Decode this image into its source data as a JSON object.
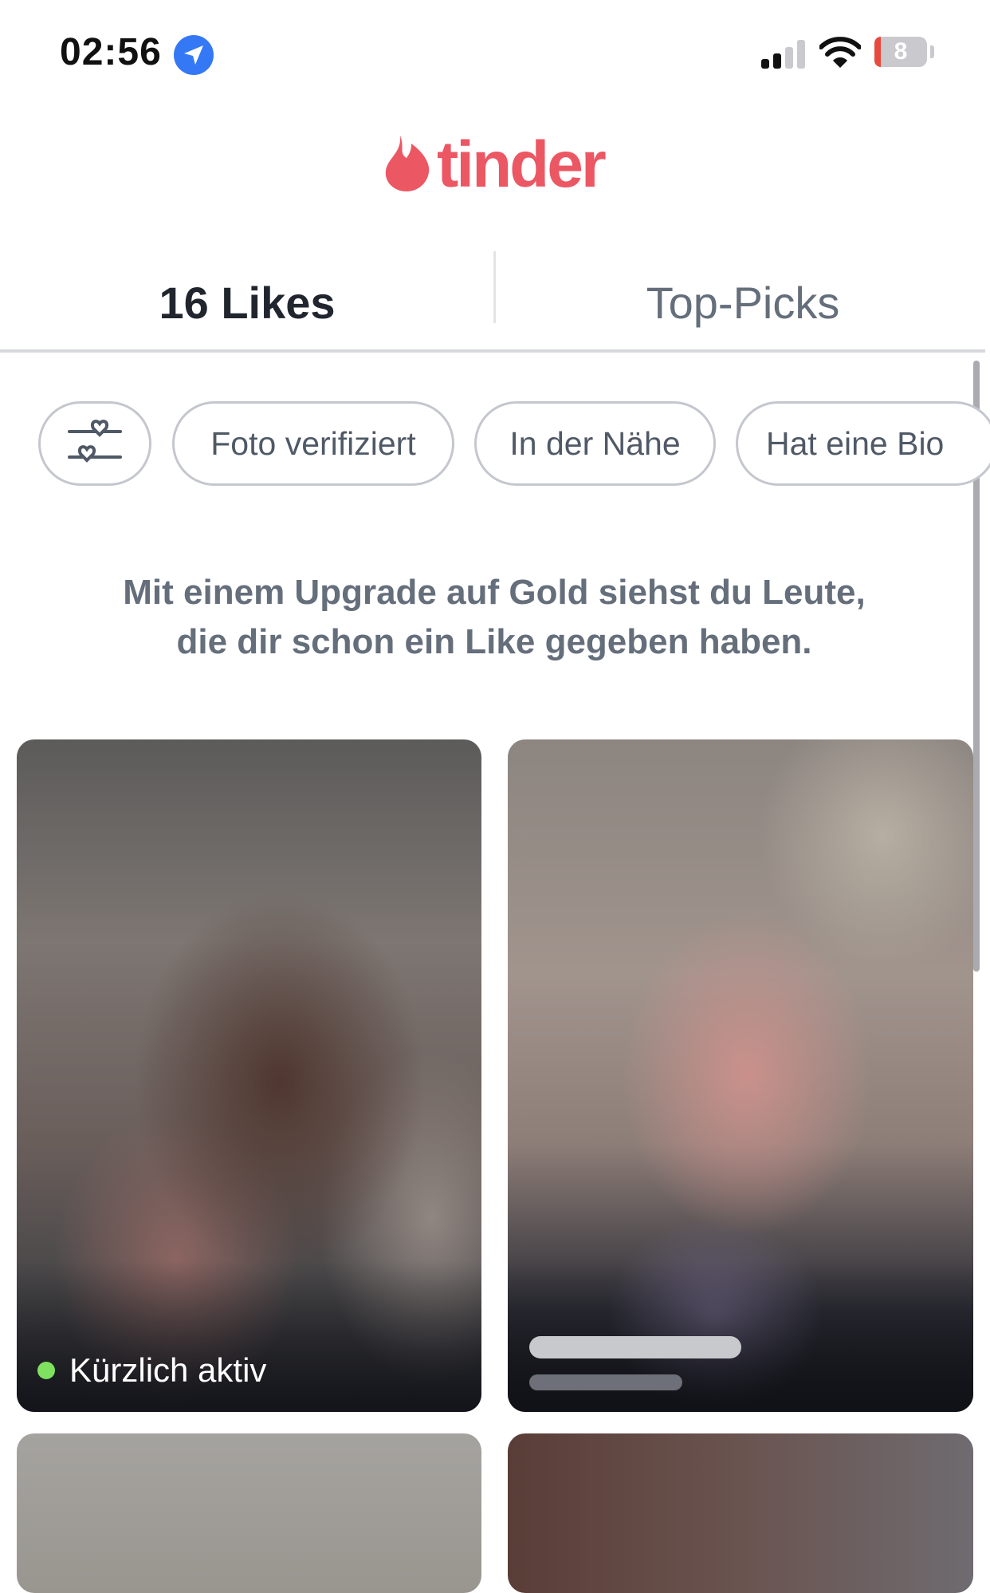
{
  "status_bar": {
    "time": "02:56",
    "battery_level": "8",
    "icons": [
      "location-arrow-icon",
      "cellular-signal-icon",
      "wifi-icon",
      "battery-icon"
    ]
  },
  "header": {
    "logo_text": "tinder",
    "brand_color": "#ec5764"
  },
  "tabs": [
    {
      "label": "16 Likes",
      "active": true
    },
    {
      "label": "Top-Picks",
      "active": false
    }
  ],
  "filters": {
    "icon": "filter-hearts-icon",
    "chips": [
      {
        "label": "Foto verifiziert"
      },
      {
        "label": "In der Nähe"
      },
      {
        "label": "Hat eine Bio"
      }
    ]
  },
  "upsell": {
    "line1": "Mit einem Upgrade auf Gold siehst du Leute,",
    "line2": "die dir schon ein Like gegeben haben."
  },
  "cards": [
    {
      "status_label": "Kürzlich aktiv",
      "status_color": "#7ee15f",
      "blurred": true
    },
    {
      "status_label": "",
      "blurred": true
    },
    {
      "blurred": true
    },
    {
      "blurred": true
    }
  ]
}
